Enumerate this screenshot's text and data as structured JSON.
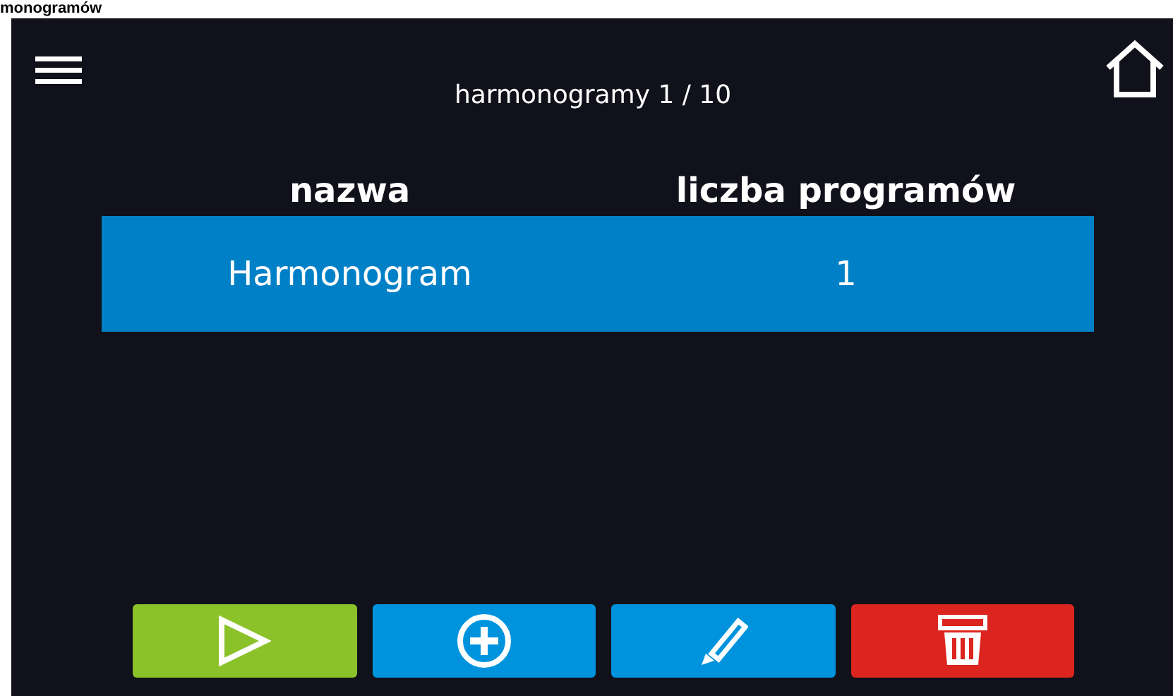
{
  "caption": "monogramów",
  "header": {
    "title": "harmonogramy 1 / 10"
  },
  "table": {
    "columns": [
      "nazwa",
      "liczba programów"
    ],
    "rows": [
      {
        "cells": [
          "Harmonogram",
          "1"
        ],
        "selected": true
      }
    ]
  },
  "buttons": [
    {
      "kind": "play"
    },
    {
      "kind": "add"
    },
    {
      "kind": "edit"
    },
    {
      "kind": "delete"
    }
  ]
}
